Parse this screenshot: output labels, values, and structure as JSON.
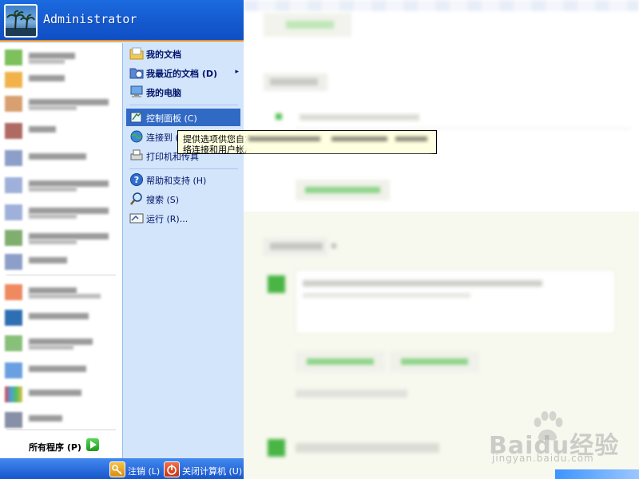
{
  "start_menu": {
    "user_name": "Administrator",
    "pinned_count_note": "",
    "right_items": [
      {
        "label": "我的文档",
        "icon": "my-documents-icon",
        "bold": true
      },
      {
        "label": "我最近的文档 (D)",
        "icon": "recent-documents-icon",
        "bold": true,
        "submenu": "▸"
      },
      {
        "label": "我的电脑",
        "icon": "my-computer-icon",
        "bold": true
      },
      {
        "label": "控制面板 (C)",
        "icon": "control-panel-icon",
        "bold": false,
        "selected": true
      },
      {
        "label": "连接到 (T)",
        "icon": "connect-to-icon",
        "bold": false
      },
      {
        "label": "打印机和传真",
        "icon": "printers-faxes-icon",
        "bold": false
      },
      {
        "label": "帮助和支持 (H)",
        "icon": "help-icon",
        "bold": false
      },
      {
        "label": "搜索 (S)",
        "icon": "search-icon",
        "bold": false
      },
      {
        "label": "运行 (R)...",
        "icon": "run-icon",
        "bold": false
      }
    ],
    "all_programs_label": "所有程序 (P)",
    "logoff_label": "注销 (L)",
    "shutdown_label": "关闭计算机 (U)"
  },
  "tooltip": {
    "line1": "提供选项供您自定",
    "line2": "络连接和用户帐户"
  },
  "watermark": {
    "brand": "Baidu经验",
    "url": "jingyan.baidu.com"
  },
  "colors": {
    "header_blue": "#1559cf",
    "accent_orange": "#e78a1c",
    "selection_blue": "#316ac5",
    "right_pane": "#d3e5fa",
    "tooltip_bg": "#ffffe1"
  }
}
